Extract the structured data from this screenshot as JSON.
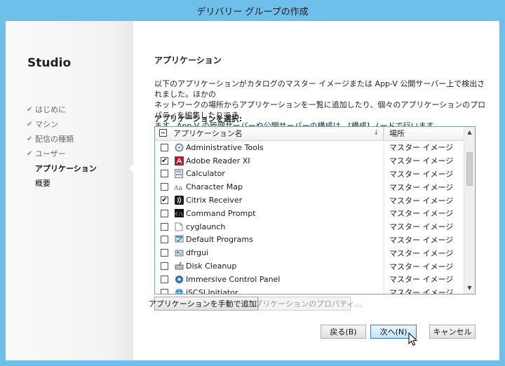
{
  "window": {
    "title": "デリバリー グループの作成"
  },
  "sidebar": {
    "app_title": "Studio",
    "steps": [
      {
        "label": "はじめに",
        "state": "done"
      },
      {
        "label": "マシン",
        "state": "done"
      },
      {
        "label": "配信の種類",
        "state": "done"
      },
      {
        "label": "ユーザー",
        "state": "done"
      },
      {
        "label": "アプリケーション",
        "state": "current"
      },
      {
        "label": "概要",
        "state": "pending"
      }
    ]
  },
  "main": {
    "heading": "アプリケーション",
    "description_lines": [
      "以下のアプリケーションがカタログのマスター イメージまたは App-V 公開サーバー上で検出されました。ほかの",
      "ネットワークの場所からアプリケーションを一覧に追加したり、個々のアプリケーションのプロパティを編集したりでき",
      "ます。App-V の管理サーバーや公開サーバーの構成は、[構成] ノードで行います。"
    ],
    "select_label": "アプリケーションを選択:",
    "table": {
      "columns": {
        "name": "アプリケーション名",
        "location": "場所"
      },
      "rows": [
        {
          "name": "Administrative Tools",
          "location": "マスター イメージ",
          "checked": false,
          "icon": "admin-tools-icon"
        },
        {
          "name": "Adobe Reader XI",
          "location": "マスター イメージ",
          "checked": true,
          "icon": "adobe-reader-icon"
        },
        {
          "name": "Calculator",
          "location": "マスター イメージ",
          "checked": false,
          "icon": "calculator-icon"
        },
        {
          "name": "Character Map",
          "location": "マスター イメージ",
          "checked": false,
          "icon": "character-map-icon"
        },
        {
          "name": "Citrix Receiver",
          "location": "マスター イメージ",
          "checked": true,
          "icon": "citrix-receiver-icon"
        },
        {
          "name": "Command Prompt",
          "location": "マスター イメージ",
          "checked": false,
          "icon": "command-prompt-icon"
        },
        {
          "name": "cyglaunch",
          "location": "マスター イメージ",
          "checked": false,
          "icon": "cyglaunch-icon"
        },
        {
          "name": "Default Programs",
          "location": "マスター イメージ",
          "checked": false,
          "icon": "default-programs-icon"
        },
        {
          "name": "dfrgui",
          "location": "マスター イメージ",
          "checked": false,
          "icon": "dfrgui-icon"
        },
        {
          "name": "Disk Cleanup",
          "location": "マスター イメージ",
          "checked": false,
          "icon": "disk-cleanup-icon"
        },
        {
          "name": "Immersive Control Panel",
          "location": "マスター イメージ",
          "checked": false,
          "icon": "control-panel-icon"
        },
        {
          "name": "iSCSI Initiator",
          "location": "マスター イメージ",
          "checked": false,
          "icon": "iscsi-icon"
        }
      ]
    },
    "add_manual_button": "アプリケーションを手動で追加...",
    "properties_button": "アプリケーションのプロパティ..."
  },
  "footer": {
    "back_button": "戻る(B)",
    "next_button": "次へ(N)",
    "cancel_button": "キャンセル"
  }
}
